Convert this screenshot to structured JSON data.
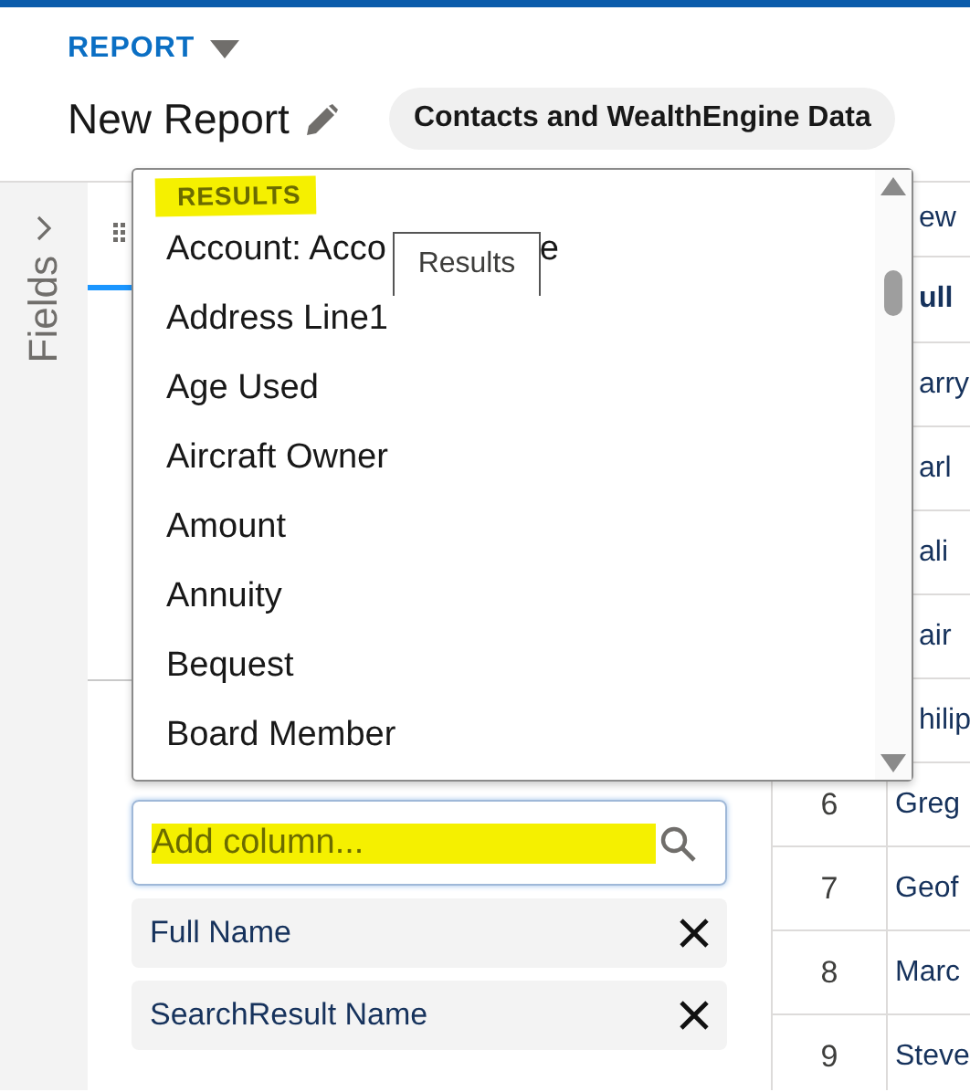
{
  "header": {
    "object_label": "REPORT",
    "title": "New Report",
    "report_type": "Contacts and WealthEngine Data"
  },
  "fields_panel": {
    "label": "Fields"
  },
  "dropdown": {
    "section": "RESULTS",
    "tooltip": "Results",
    "items": [
      {
        "label": "Account: Acco",
        "label_end": "e"
      },
      {
        "label": "Address Line1"
      },
      {
        "label": "Age Used"
      },
      {
        "label": "Aircraft Owner"
      },
      {
        "label": "Amount"
      },
      {
        "label": "Annuity"
      },
      {
        "label": "Bequest"
      },
      {
        "label": "Board Member"
      }
    ]
  },
  "columns_panel": {
    "search": {
      "placeholder": "Add column..."
    },
    "chips": [
      {
        "label": "Full Name"
      },
      {
        "label": "SearchResult Name"
      }
    ]
  },
  "table": {
    "top_text": "ew",
    "column_header": "ull",
    "rows": [
      {
        "name": "arry"
      },
      {
        "name": "arl"
      },
      {
        "name": "ali"
      },
      {
        "name": "air"
      },
      {
        "name": "hilip"
      },
      {
        "number": "6",
        "name": "Greg"
      },
      {
        "number": "7",
        "name": "Geof"
      },
      {
        "number": "8",
        "name": "Marc"
      },
      {
        "number": "9",
        "name": "Steve"
      }
    ]
  }
}
